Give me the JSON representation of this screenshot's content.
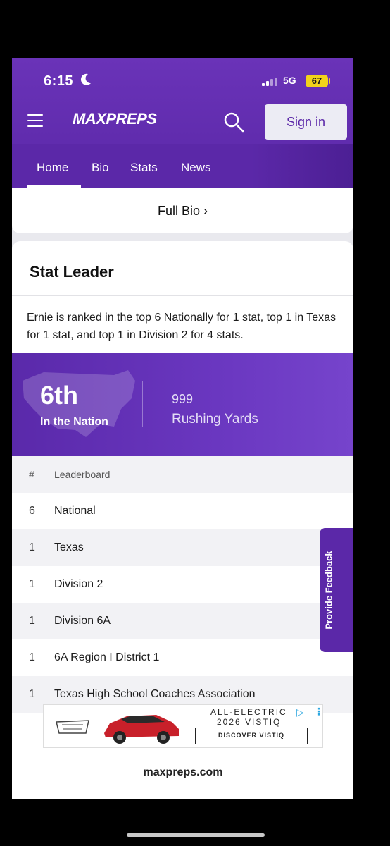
{
  "status_bar": {
    "time": "6:15",
    "network": "5G",
    "battery": "67"
  },
  "header": {
    "logo": "MAXPREPS",
    "signin_label": "Sign in"
  },
  "tabs": [
    {
      "label": "Home",
      "active": true
    },
    {
      "label": "Bio"
    },
    {
      "label": "Stats"
    },
    {
      "label": "News"
    }
  ],
  "bio_link": "Full Bio ›",
  "stat_leader": {
    "title": "Stat Leader",
    "description": "Ernie is ranked in the top 6 Nationally for 1 stat, top 1 in Texas for 1 stat, and top 1 in Division 2 for 4 stats.",
    "rank": "6th",
    "rank_scope": "In the Nation",
    "stat_value": "999",
    "stat_name": "Rushing Yards"
  },
  "table": {
    "headers": {
      "num": "#",
      "label": "Leaderboard"
    },
    "rows": [
      {
        "num": "6",
        "label": "National"
      },
      {
        "num": "1",
        "label": "Texas"
      },
      {
        "num": "1",
        "label": "Division 2"
      },
      {
        "num": "1",
        "label": "Division 6A"
      },
      {
        "num": "1",
        "label": "6A Region I District 1"
      },
      {
        "num": "1",
        "label": "Texas High School Coaches Association"
      }
    ]
  },
  "feedback_label": "Provide Feedback",
  "ad": {
    "line1": "ALL-ELECTRIC",
    "line2": "2026 VISTIQ",
    "cta": "DISCOVER VISTIQ"
  },
  "url": "maxpreps.com",
  "colors": {
    "brand_purple": "#5b28a8",
    "battery_yellow": "#f2d21b"
  }
}
